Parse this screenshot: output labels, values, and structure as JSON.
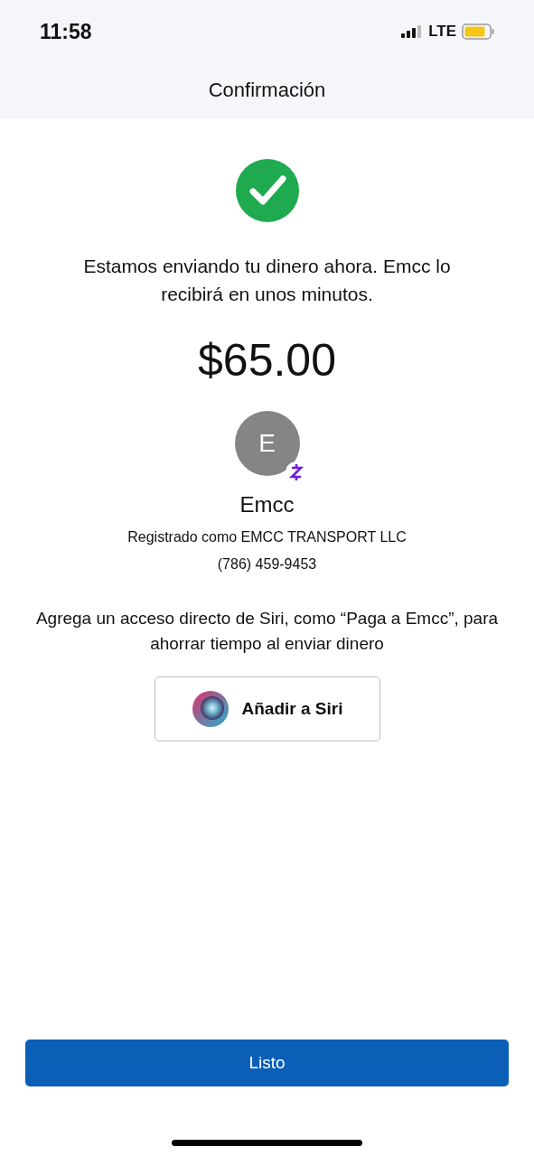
{
  "status_bar": {
    "time": "11:58",
    "network": "LTE"
  },
  "header": {
    "title": "Confirmación"
  },
  "message": "Estamos enviando tu dinero ahora. Emcc lo recibirá en unos minutos.",
  "amount": "$65.00",
  "recipient": {
    "initial": "E",
    "name": "Emcc",
    "registered_as": "Registrado como EMCC TRANSPORT LLC",
    "phone": "(786) 459-9453"
  },
  "siri": {
    "prompt": "Agrega un acceso directo de Siri, como “Paga a Emcc”, para ahorrar tiempo al enviar dinero",
    "button": "Añadir a Siri"
  },
  "done_button": "Listo"
}
